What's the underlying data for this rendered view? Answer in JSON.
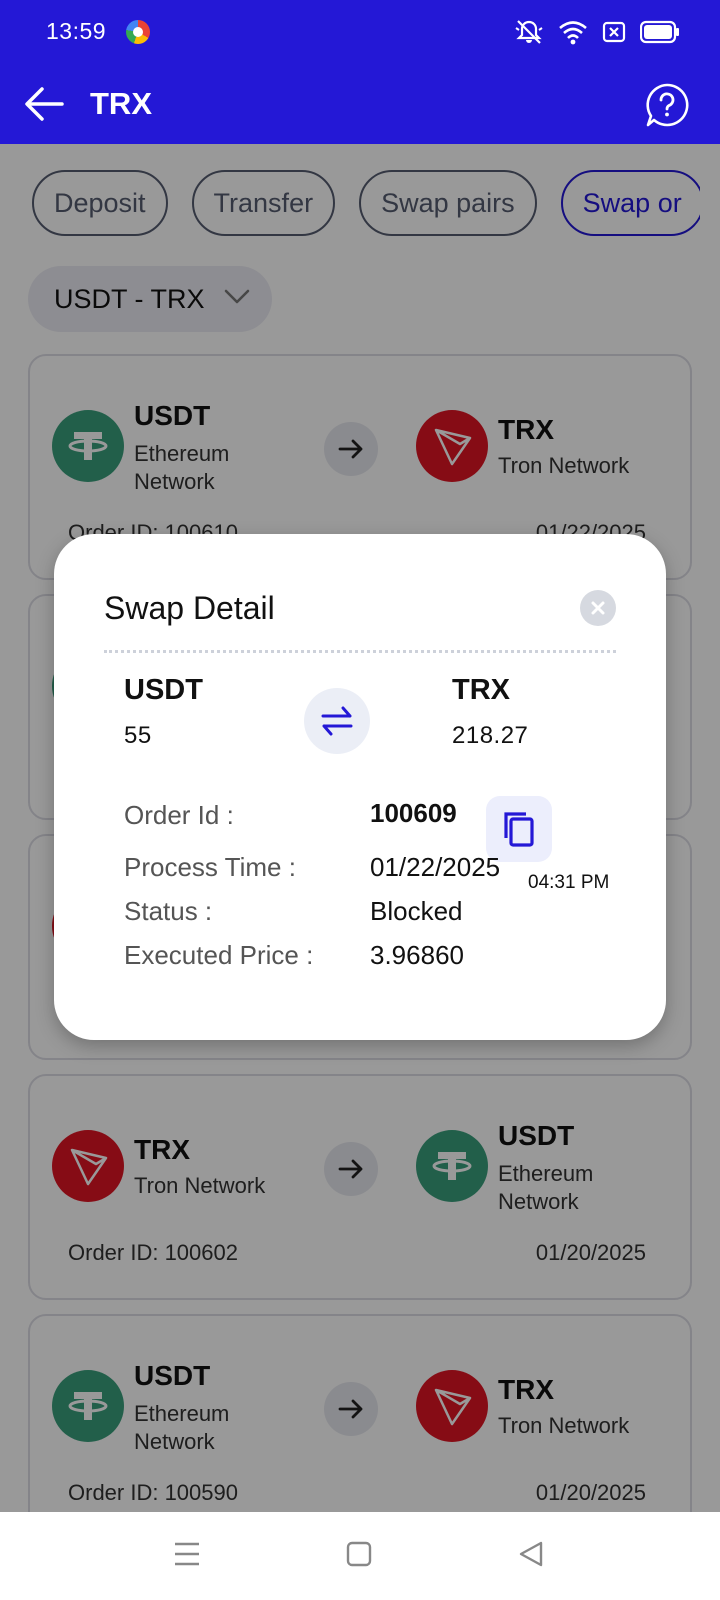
{
  "status_bar": {
    "time": "13:59"
  },
  "app_bar": {
    "title": "TRX"
  },
  "tabs": [
    {
      "label": "Deposit"
    },
    {
      "label": "Transfer"
    },
    {
      "label": "Swap pairs"
    },
    {
      "label": "Swap or"
    }
  ],
  "pair_filter": {
    "selected": "USDT - TRX"
  },
  "orders": [
    {
      "from_symbol": "USDT",
      "from_network": "Ethereum Network",
      "to_symbol": "TRX",
      "to_network": "Tron Network",
      "order_id": "Order ID: 100610",
      "date": "01/22/2025"
    },
    {
      "from_symbol": "TRX",
      "from_network": "Tron Network",
      "to_symbol": "USDT",
      "to_network": "Ethereum Network",
      "order_id": "Order ID: 100602",
      "date": "01/20/2025"
    },
    {
      "from_symbol": "USDT",
      "from_network": "Ethereum Network",
      "to_symbol": "TRX",
      "to_network": "Tron Network",
      "order_id": "Order ID: 100590",
      "date": "01/20/2025"
    }
  ],
  "modal": {
    "title": "Swap Detail",
    "from_symbol": "USDT",
    "from_amount": "55",
    "to_symbol": "TRX",
    "to_amount": "218.27",
    "order_id_label": "Order Id :",
    "order_id_value": "100609",
    "process_time_label": "Process Time :",
    "process_date": "01/22/2025",
    "process_time": "04:31 PM",
    "status_label": "Status :",
    "status_value": "Blocked",
    "price_label": "Executed Price :",
    "price_value": "3.96860"
  },
  "colors": {
    "primary": "#2418d6",
    "usdt": "#3a9e7c",
    "trx": "#e01524"
  }
}
